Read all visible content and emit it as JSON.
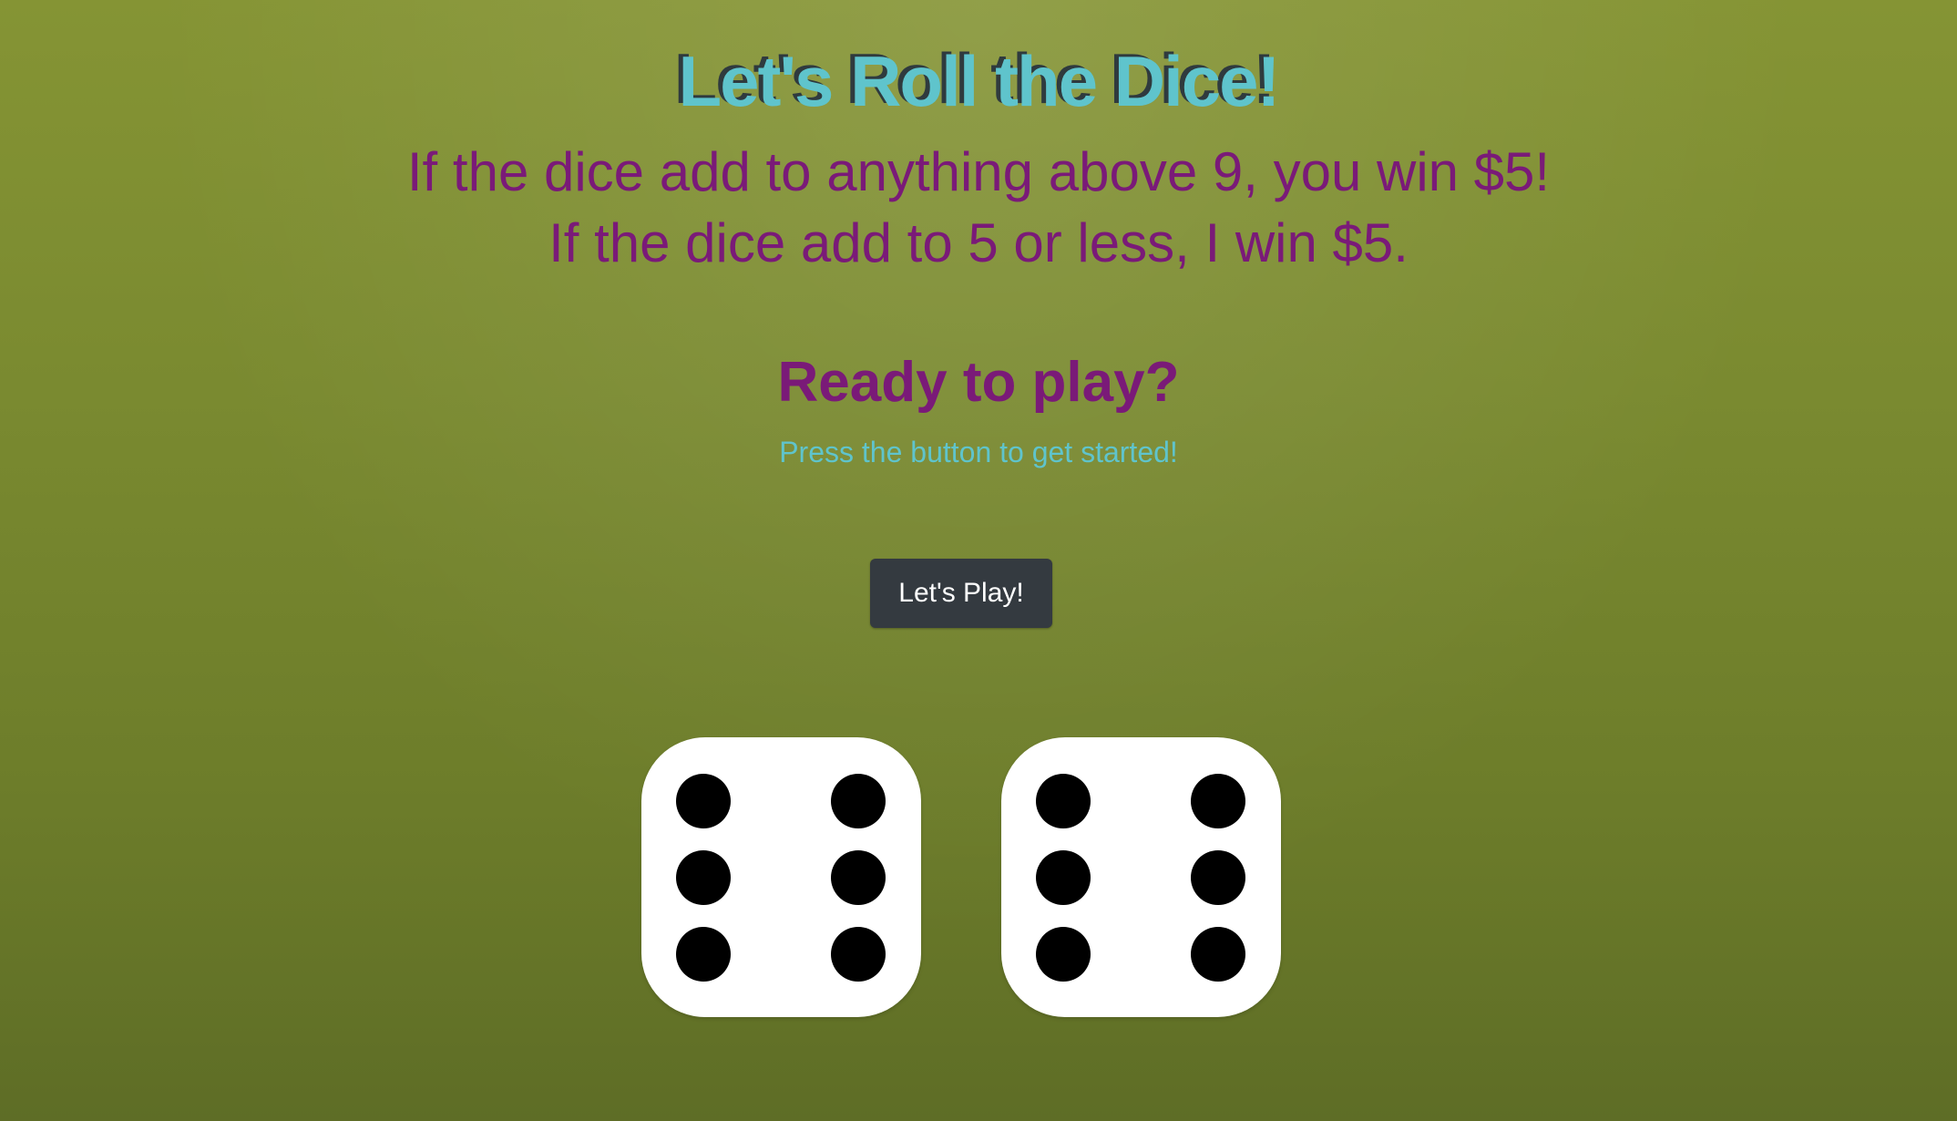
{
  "header": {
    "title": "Let's Roll the Dice!"
  },
  "rules": {
    "win_line": "If the dice add to anything above 9, you win $5!",
    "lose_line": "If the dice add to 5 or less, I win $5."
  },
  "prompt": {
    "heading": "Ready to play?",
    "hint": "Press the button to get started!"
  },
  "controls": {
    "play_label": "Let's Play!"
  },
  "dice": [
    {
      "value": 6
    },
    {
      "value": 6
    }
  ],
  "colors": {
    "title": "#5fc4cc",
    "title_shadow": "#2f3a3e",
    "rules_text": "#7a1a78",
    "hint_text": "#5fc4cc",
    "button_bg": "#343a40",
    "felt": "#7a8a30"
  }
}
